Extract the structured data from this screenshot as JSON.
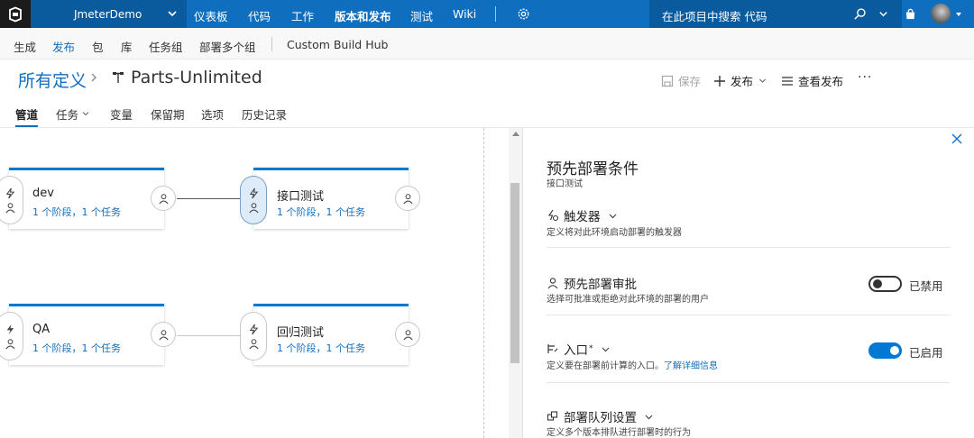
{
  "topbar": {
    "project_name": "JmeterDemo",
    "nav": [
      "仪表板",
      "代码",
      "工作",
      "版本和发布",
      "测试",
      "Wiki"
    ],
    "search_placeholder": "在此项目中搜索 代码"
  },
  "subnav": {
    "items": [
      "生成",
      "发布",
      "包",
      "库",
      "任务组",
      "部署多个组"
    ],
    "active": "发布",
    "extra": "Custom Build Hub"
  },
  "breadcrumb": {
    "root": "所有定义",
    "title": "Parts-Unlimited"
  },
  "toolbar": {
    "save": "保存",
    "release": "发布",
    "view_releases": "查看发布",
    "more": "···"
  },
  "tabs": {
    "items": [
      "管道",
      "任务",
      "变量",
      "保留期",
      "选项",
      "历史记录"
    ],
    "active": "管道"
  },
  "stages": [
    {
      "name": "dev",
      "desc": "1 个阶段，1 个任务"
    },
    {
      "name": "接口测试",
      "desc": "1 个阶段，1 个任务"
    },
    {
      "name": "QA",
      "desc": "1 个阶段，1 个任务"
    },
    {
      "name": "回归测试",
      "desc": "1 个阶段，1 个任务"
    }
  ],
  "panel": {
    "title": "预先部署条件",
    "subtitle": "接口测试",
    "sections": [
      {
        "title": "触发器",
        "desc": "定义将对此环境启动部署的触发器"
      },
      {
        "title": "预先部署审批",
        "desc": "选择可批准或拒绝对此环境的部署的用户",
        "toggle": "已禁用",
        "toggle_on": false
      },
      {
        "title": "入口",
        "desc": "定义要在部署前计算的入口。",
        "link": "了解详细信息",
        "toggle": "已启用",
        "toggle_on": true
      },
      {
        "title": "部署队列设置",
        "desc": "定义多个版本排队进行部署时的行为"
      }
    ]
  },
  "colors": {
    "topbar": "#106ebe",
    "accent": "#0078d4"
  }
}
